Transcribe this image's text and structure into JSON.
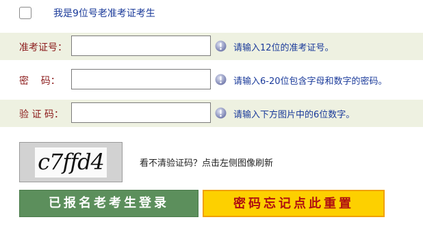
{
  "checkbox": {
    "label": "我是9位号老准考证考生",
    "checked": false
  },
  "fields": [
    {
      "label": "准考证号：",
      "value": "",
      "hint": "请输入12位的准考证号。"
    },
    {
      "label": "密    码：",
      "value": "",
      "hint": "请输入6-20位包含字母和数字的密码。"
    },
    {
      "label": "验 证 码：",
      "value": "",
      "hint": "请输入下方图片中的6位数字。"
    }
  ],
  "captcha": {
    "text": "c7ffd4",
    "refresh_label": "看不清验证码？点击左侧图像刷新"
  },
  "buttons": {
    "login": "已报名老考生登录",
    "reset": "密码忘记点此重置"
  },
  "colors": {
    "label": "#8b1a1a",
    "hint": "#1a3a9a",
    "row_shade": "#eef1e1",
    "login_bg": "#5c8f5c",
    "reset_bg": "#fdd000",
    "reset_text": "#b01010"
  },
  "icons": {
    "info": "info-icon"
  }
}
